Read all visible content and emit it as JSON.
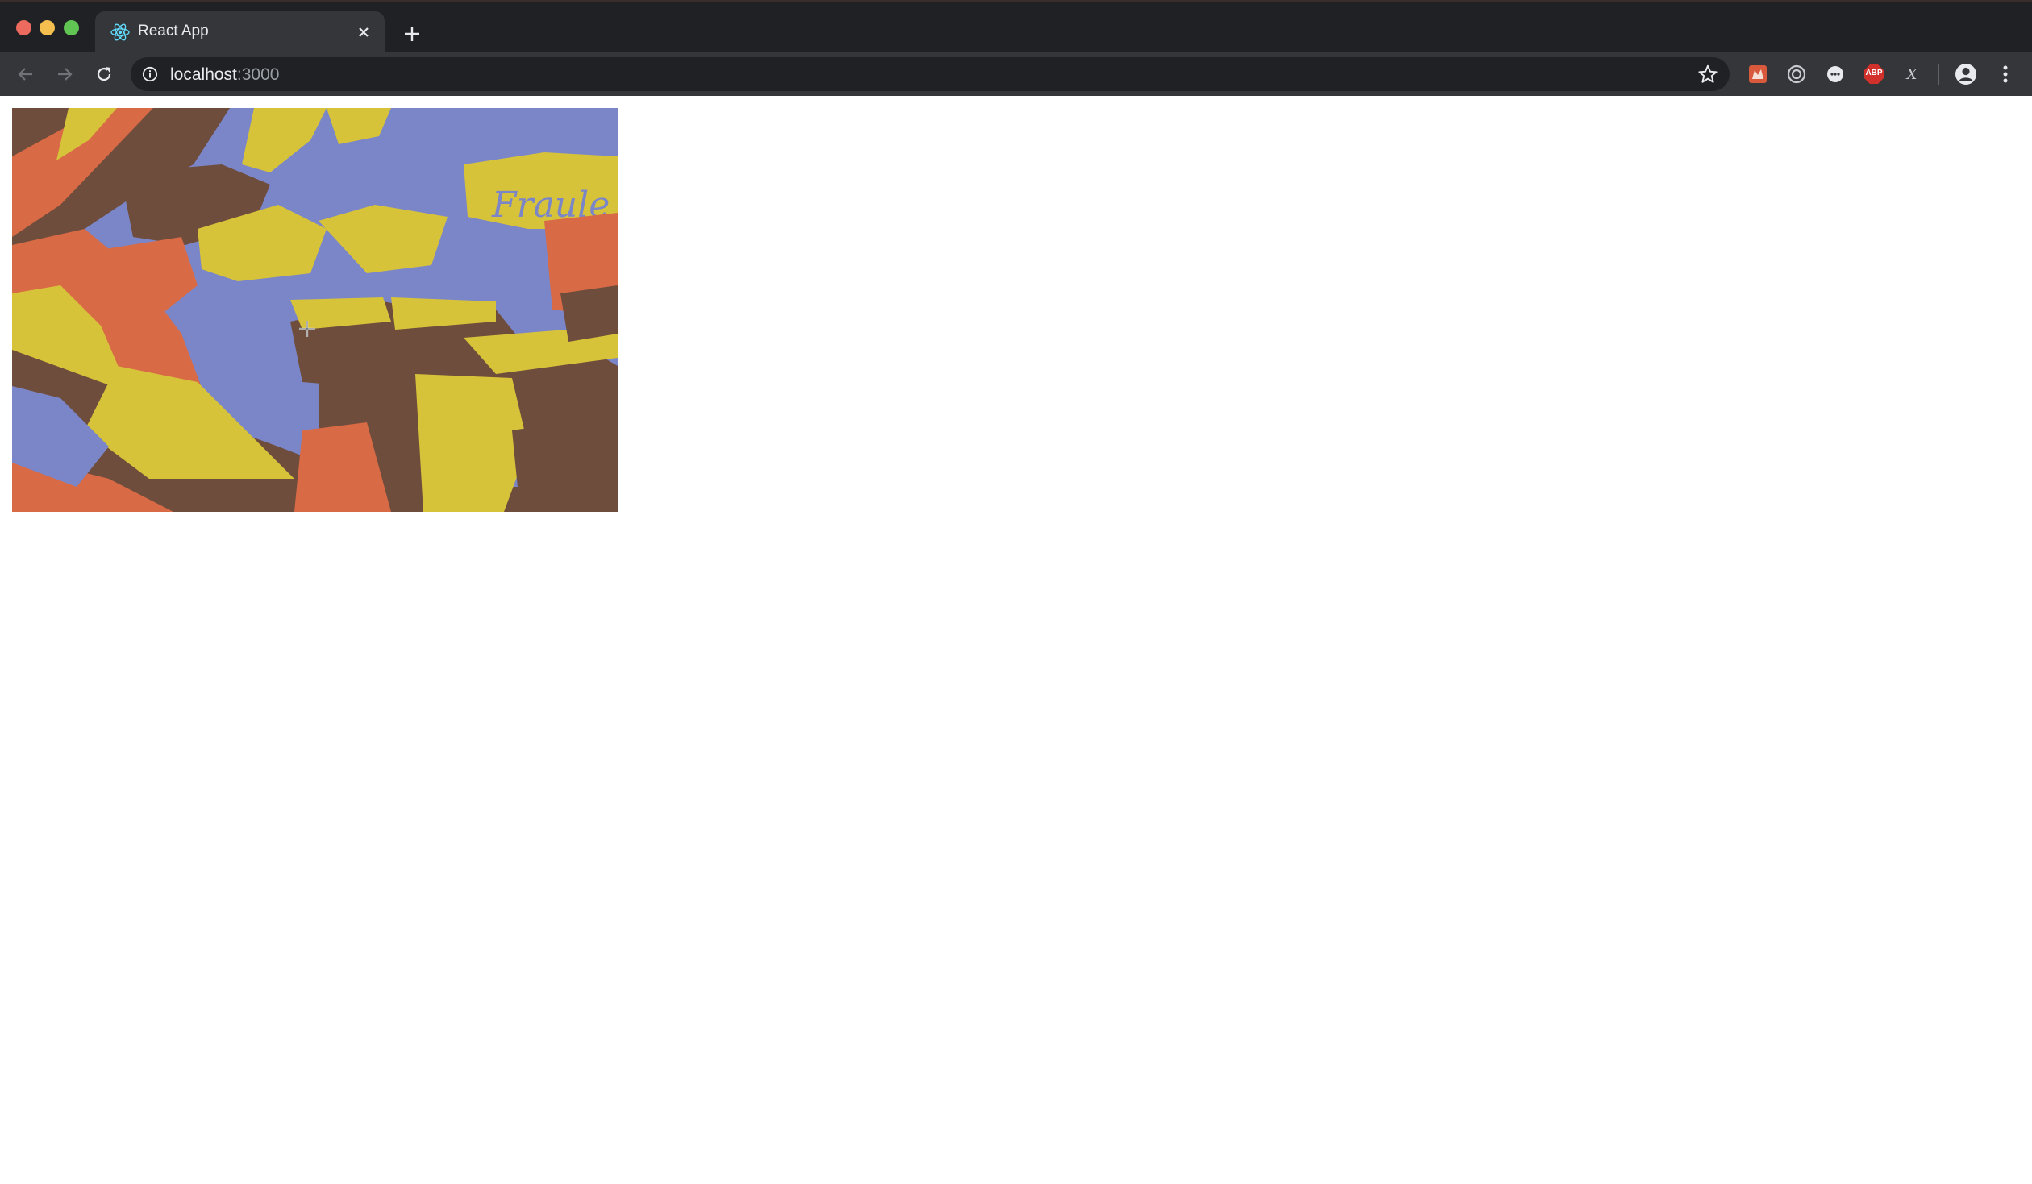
{
  "tab": {
    "title": "React App"
  },
  "address_bar": {
    "host": "localhost",
    "port": ":3000"
  },
  "extensions": [
    {
      "icon": "extension-red-icon"
    },
    {
      "icon": "extension-circle-icon"
    },
    {
      "icon": "extension-chat-icon"
    },
    {
      "icon": "adblock-plus-icon",
      "label": "ABP"
    },
    {
      "icon": "extension-x-icon",
      "label": "X"
    }
  ],
  "colors": {
    "image_blue": "#7b86c8",
    "image_yellow": "#d7c33a",
    "image_orange": "#d86a45",
    "image_brown": "#6f4d3c"
  }
}
